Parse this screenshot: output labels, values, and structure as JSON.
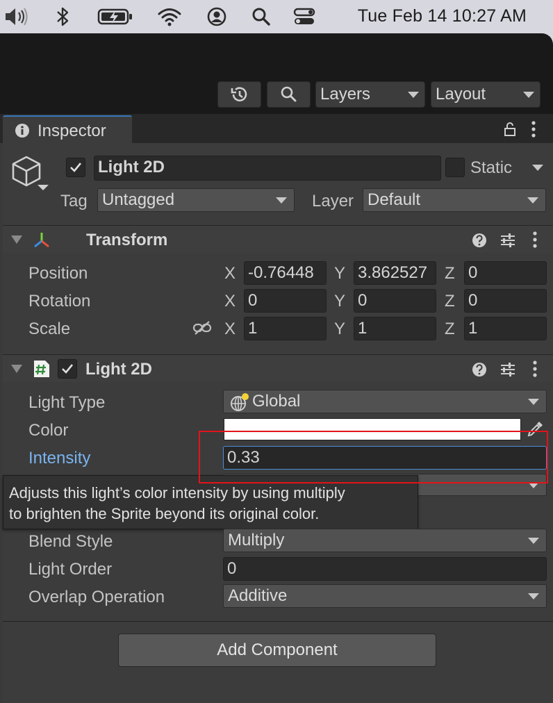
{
  "menubar": {
    "clock": "Tue Feb 14  10:27 AM",
    "icons": [
      "volume-icon",
      "bluetooth-icon",
      "battery-charging-icon",
      "wifi-icon",
      "user-icon",
      "search-icon",
      "control-center-icon"
    ]
  },
  "toolbar": {
    "layers_label": "Layers",
    "layout_label": "Layout",
    "icons": [
      "history-icon",
      "search-icon"
    ]
  },
  "inspector": {
    "tab_label": "Inspector",
    "object": {
      "name": "Light 2D",
      "active": true,
      "static_label": "Static",
      "static": false,
      "tag_label": "Tag",
      "tag_value": "Untagged",
      "layer_label": "Layer",
      "layer_value": "Default"
    },
    "transform": {
      "title": "Transform",
      "rows": [
        {
          "label": "Position",
          "x": "-0.76448",
          "y": "3.862527",
          "z": "0"
        },
        {
          "label": "Rotation",
          "x": "0",
          "y": "0",
          "z": "0"
        },
        {
          "label": "Scale",
          "x": "1",
          "y": "1",
          "z": "1"
        }
      ],
      "axis_x": "X",
      "axis_y": "Y",
      "axis_z": "Z"
    },
    "light2d": {
      "title": "Light 2D",
      "enabled": true,
      "light_type_label": "Light Type",
      "light_type_value": "Global",
      "color_label": "Color",
      "color_value": "#ffffff",
      "intensity_label": "Intensity",
      "intensity_value": "0.33",
      "blend_style_label": "Blend Style",
      "blend_style_value": "Multiply",
      "light_order_label": "Light Order",
      "light_order_value": "0",
      "overlap_label": "Overlap Operation",
      "overlap_value": "Additive"
    },
    "tooltip_line1": "Adjusts this light’s color intensity by using multiply",
    "tooltip_line2": "to brighten the Sprite beyond its original color.",
    "add_component_label": "Add Component"
  },
  "colors": {
    "highlight": "#e3131b",
    "intensity_label": "#7ab4f0",
    "tab_accent": "#3a79bb"
  }
}
